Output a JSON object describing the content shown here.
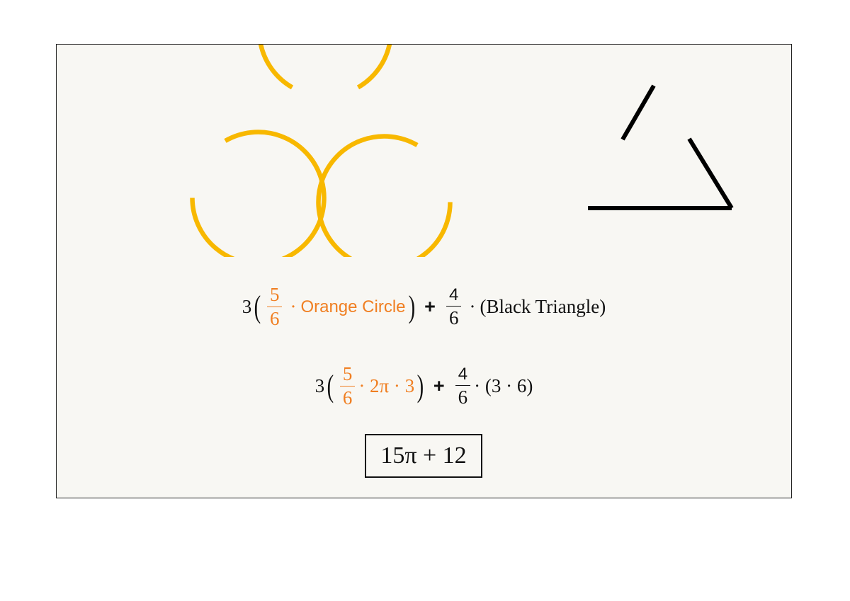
{
  "diagram": {
    "colors": {
      "circle": "#f8b800",
      "triangle": "#000000",
      "orange_text": "#f07f22",
      "panel": "#f8f7f3"
    },
    "shapes": [
      {
        "kind": "partial-circle",
        "color": "#f8b800",
        "fraction": "5/6"
      },
      {
        "kind": "partial-circle",
        "color": "#f8b800",
        "fraction": "5/6"
      },
      {
        "kind": "partial-circle",
        "color": "#f8b800",
        "fraction": "5/6"
      },
      {
        "kind": "partial-triangle",
        "color": "#000000",
        "fraction": "4/6"
      }
    ]
  },
  "equation1": {
    "coef": "3",
    "frac_num": "5",
    "frac_den": "6",
    "dot": "·",
    "term": "Orange Circle",
    "plus": "+",
    "frac2_num": "4",
    "frac2_den": "6",
    "dot2": "·",
    "term2": "(Black Triangle)"
  },
  "equation2": {
    "coef": "3",
    "frac_num": "5",
    "frac_den": "6",
    "term": "· 2π · 3",
    "plus": "+",
    "frac2_num": "4",
    "frac2_den": "6",
    "term2": "· (3 · 6)"
  },
  "answer": "15π + 12"
}
